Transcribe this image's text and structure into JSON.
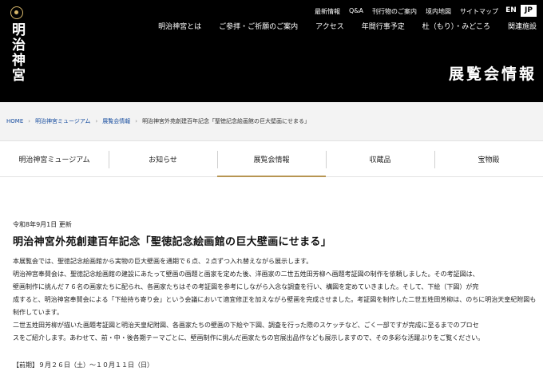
{
  "logo": {
    "text": "明治神宮"
  },
  "utility_nav": [
    "最新情報",
    "Q&A",
    "刊行物のご案内",
    "境内地図",
    "サイトマップ"
  ],
  "lang": {
    "en": "EN",
    "jp": "JP"
  },
  "main_nav": [
    "明治神宮とは",
    "ご参拝・ご祈願のご案内",
    "アクセス",
    "年間行事予定",
    "杜（もり）・みどころ",
    "関連施設"
  ],
  "page_heading": "展覧会情報",
  "breadcrumb": {
    "home": "HOME",
    "museum": "明治神宮ミュージアム",
    "exhibition": "展覧会情報",
    "current": "明治神宮外苑創建百年記念「聖徳記念絵画館の巨大壁画にせまる」"
  },
  "subnav": [
    "明治神宮ミュージアム",
    "お知らせ",
    "展覧会情報",
    "収蔵品",
    "宝物殿"
  ],
  "article": {
    "update": "令和8年9月1日 更新",
    "title": "明治神宮外苑創建百年記念「聖徳記念絵画館の巨大壁画にせまる」",
    "lines": [
      "本展覧会では、聖徳記念絵画館から実物の巨大壁画を通期で６点、２点ずつ入れ替えながら展示します。",
      "明治神宮奉賛会は、聖徳記念絵画館の建設にあたって壁画の画題と画家を定めた後、洋画家の二世五姓田芳柳へ画題考証図の制作を依頼しました。その考証図は、",
      "壁画制作に挑んだ７６名の画家たちに配られ、各画家たちはその考証図を参考にしながら入念な調査を行い、構図を定めていきました。そして、下絵（下図）が完",
      "成すると、明治神宮奉賛会による「下絵持ち寄り会」という会議において適宜修正を加えながら壁画を完成させました。考証図を制作した二世五姓田芳柳は、のちに明治天皇紀附図も制作しています。",
      "二世五姓田芳柳が描いた画題考証図と明治天皇紀附図、各画家たちの壁画の下絵や下図、調査を行った際のスケッチなど、ごく一部ですが完成に至るまでのプロセ",
      "スをご紹介します。あわせて、前・中・後各期テーマごとに、壁画制作に挑んだ画家たちの官展出品作なども展示しますので、その多彩な活躍ぶりをご覧ください。"
    ],
    "period": "【前期】９月２６日（土）〜１０月１１日（日）"
  }
}
